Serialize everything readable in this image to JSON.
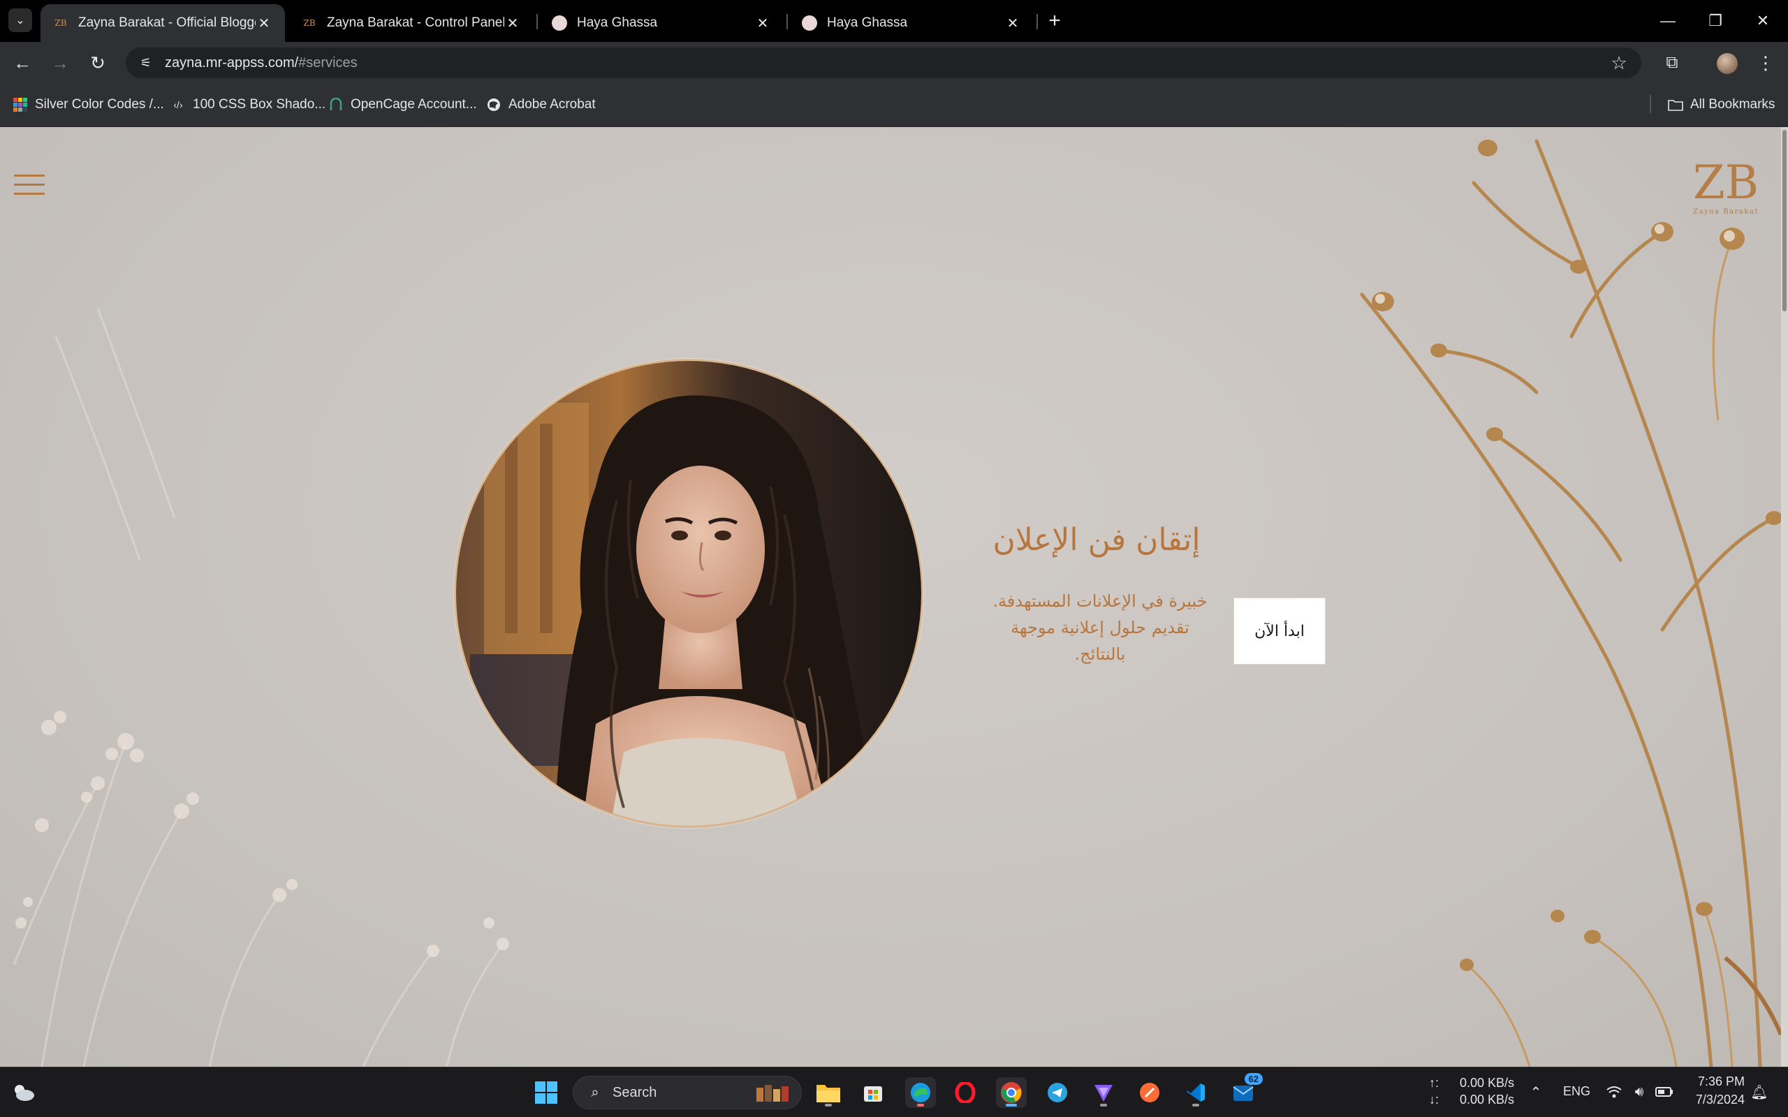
{
  "browser": {
    "tabs": [
      {
        "title": "Zayna Barakat - Official Blogger",
        "favicon": "zb-logo-icon",
        "active": true
      },
      {
        "title": "Zayna Barakat - Control Panel",
        "favicon": "zb-logo-icon",
        "active": false
      },
      {
        "title": "Haya Ghassa",
        "favicon": "round-avatar-icon",
        "active": false
      },
      {
        "title": "Haya Ghassa",
        "favicon": "round-avatar-icon",
        "active": false
      }
    ],
    "favicon_text": "ZB",
    "url_host": "zayna.mr-appss.com/",
    "url_path": "#services",
    "bookmarks": [
      {
        "label": "Silver Color Codes /...",
        "icon": "color-grid-icon"
      },
      {
        "label": "100 CSS Box Shado...",
        "icon": "code-icon"
      },
      {
        "label": "OpenCage Account...",
        "icon": "opencage-icon"
      },
      {
        "label": "Adobe Acrobat",
        "icon": "globe-icon"
      }
    ],
    "all_bookmarks": "All Bookmarks"
  },
  "page": {
    "logo_monogram": "ZB",
    "logo_caption": "Zayna Barakat",
    "hero_title": "إتقان فن الإعلان",
    "hero_desc_lines": [
      "خبيرة في الإعلانات المستهدفة.",
      "تقديم حلول إعلانية موجهة",
      "بالنتائج."
    ],
    "cta_label": "ابدأ الآن",
    "accent_color": "#b8763f",
    "background_color": "#c9c4c0"
  },
  "taskbar": {
    "search_label": "Search",
    "mail_badge": "62",
    "net_up": "0.00 KB/s",
    "net_down": "0.00 KB/s",
    "net_up_arrow": "↑:",
    "net_down_arrow": "↓:",
    "language": "ENG",
    "time": "7:36 PM",
    "date": "7/3/2024"
  }
}
